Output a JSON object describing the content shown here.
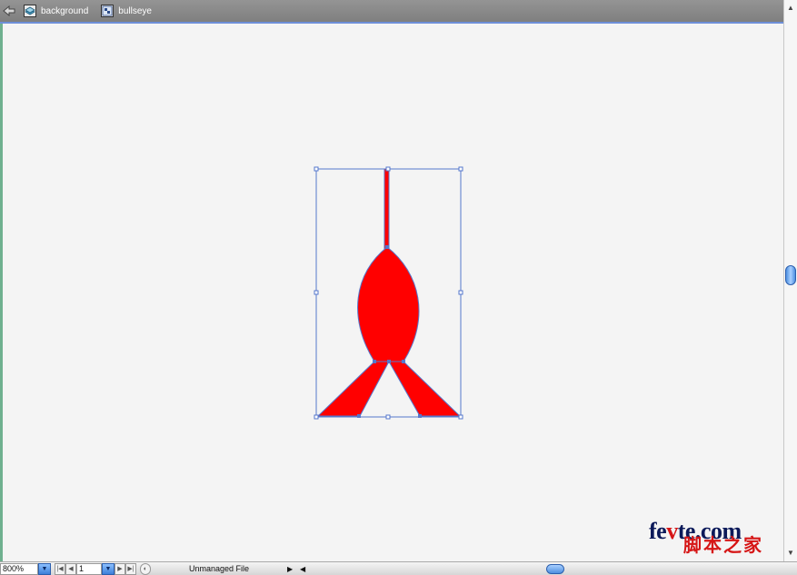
{
  "breadcrumb": {
    "items": [
      {
        "label": "background",
        "icon": "layer-icon"
      },
      {
        "label": "bullseye",
        "icon": "symbol-icon"
      }
    ]
  },
  "status": {
    "zoom": "800%",
    "page": "1",
    "message": "Unmanaged File"
  },
  "watermark": {
    "brand_prefix": "fe",
    "brand_accent": "v",
    "brand_suffix": "te.com",
    "chinese": "脚本之家"
  },
  "colors": {
    "shape_fill": "#ff0000",
    "selection": "#5577cc",
    "accent": "#6d8fd8"
  }
}
